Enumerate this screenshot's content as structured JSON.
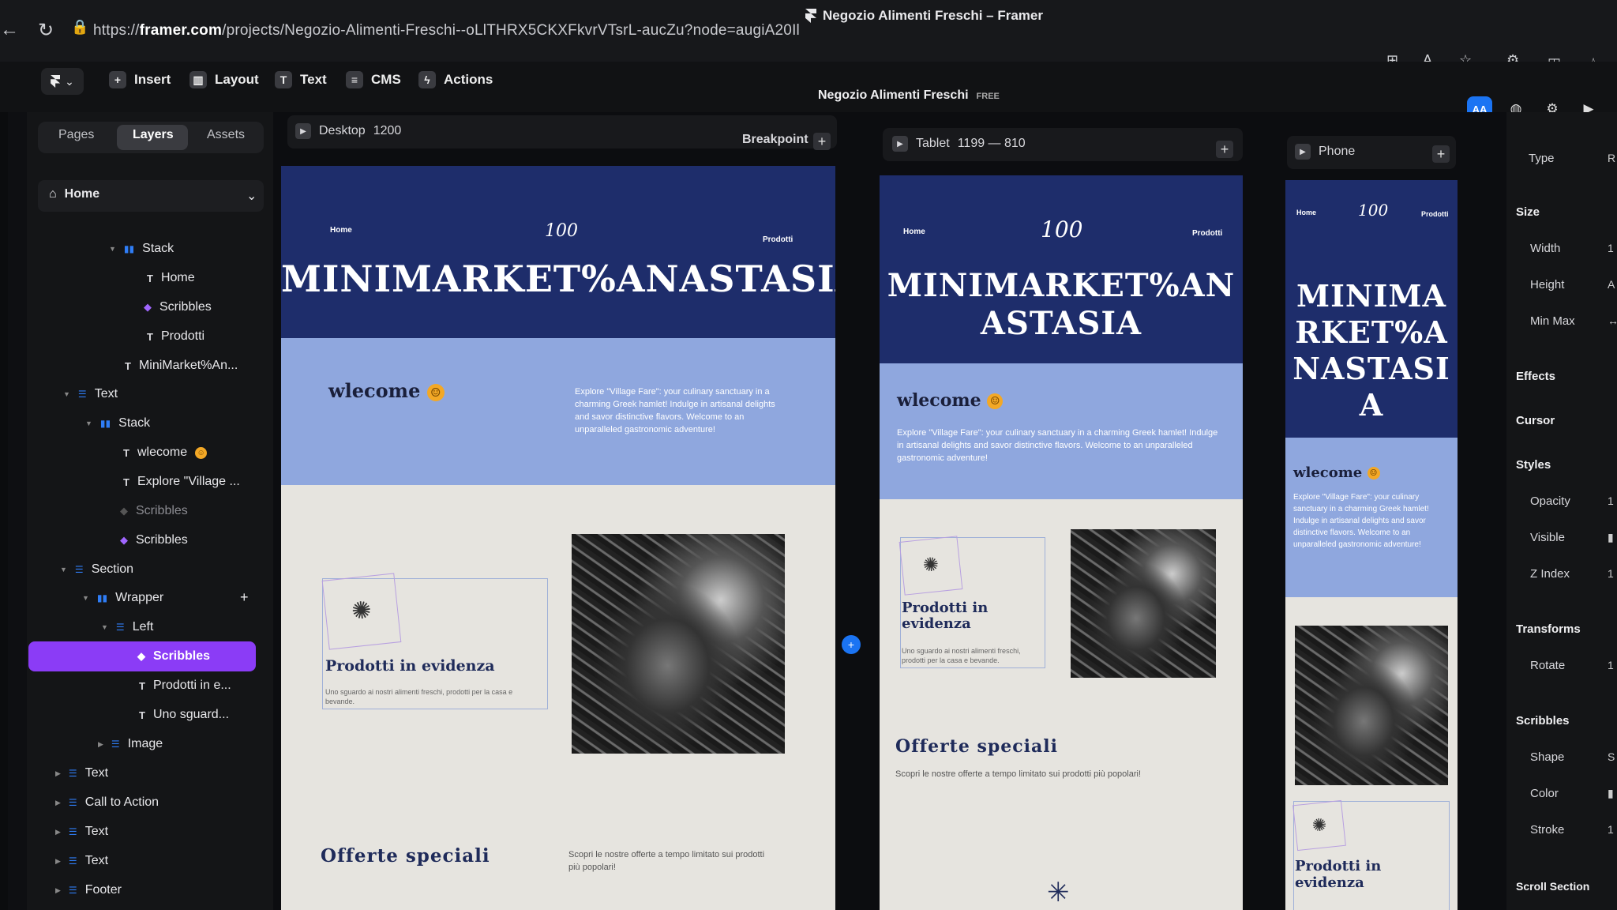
{
  "browser": {
    "tab_title": "Negozio Alimenti Freschi – Framer",
    "url_prefix": "https://",
    "url_host": "framer.com",
    "url_path": "/projects/Negozio-Alimenti-Freschi--oLlTHRX5CKXFkvrVTsrL-aucZu?node=augiA20Il"
  },
  "toolbar": {
    "insert": "Insert",
    "layout": "Layout",
    "text": "Text",
    "cms": "CMS",
    "actions": "Actions",
    "project_name": "Negozio Alimenti Freschi",
    "plan": "FREE",
    "aa": "AA"
  },
  "left_panel": {
    "tabs": [
      "Pages",
      "Layers",
      "Assets"
    ],
    "page_select": "Home",
    "layers": [
      {
        "label": "Stack",
        "kind": "stack"
      },
      {
        "label": "Home",
        "kind": "text"
      },
      {
        "label": "Scribbles",
        "kind": "component"
      },
      {
        "label": "Prodotti",
        "kind": "text"
      },
      {
        "label": "MiniMarket%An...",
        "kind": "text"
      },
      {
        "label": "Text",
        "kind": "stack"
      },
      {
        "label": "Stack",
        "kind": "stack"
      },
      {
        "label": "wlecome",
        "kind": "text"
      },
      {
        "label": "Explore \"Village ...",
        "kind": "text"
      },
      {
        "label": "Scribbles",
        "kind": "component"
      },
      {
        "label": "Scribbles",
        "kind": "component"
      },
      {
        "label": "Section",
        "kind": "stack"
      },
      {
        "label": "Wrapper",
        "kind": "stack"
      },
      {
        "label": "Left",
        "kind": "stack"
      },
      {
        "label": "Scribbles",
        "kind": "component"
      },
      {
        "label": "Prodotti in e...",
        "kind": "text"
      },
      {
        "label": "Uno sguard...",
        "kind": "text"
      },
      {
        "label": "Image",
        "kind": "stack"
      },
      {
        "label": "Text",
        "kind": "stack"
      },
      {
        "label": "Call to Action",
        "kind": "stack"
      },
      {
        "label": "Text",
        "kind": "stack"
      },
      {
        "label": "Text",
        "kind": "stack"
      },
      {
        "label": "Footer",
        "kind": "stack"
      }
    ]
  },
  "canvas": {
    "desktop_label": "Desktop",
    "desktop_width": "1200",
    "breakpoint": "Breakpoint",
    "tablet_label": "Tablet",
    "tablet_range": "1199 — 810",
    "phone_label": "Phone"
  },
  "site": {
    "nav_home": "Home",
    "nav_prodotti": "Prodotti",
    "logo": "100",
    "title": "MINIMARKET%ANASTASIA",
    "title_tablet_1": "MINIMARKET%AN",
    "title_tablet_2": "ASTASIA",
    "title_phone_1": "MINIMA",
    "title_phone_2": "RKET%A",
    "title_phone_3": "NASTASI",
    "title_phone_4": "A",
    "welcome": "wlecome",
    "welcome_text": "Explore \"Village Fare\": your culinary sanctuary in a charming Greek hamlet! Indulge in artisanal delights and savor distinctive flavors. Welcome to an unparalleled gastronomic adventure!",
    "featured_title": "Prodotti in evidenza",
    "featured_text": "Uno sguardo ai nostri alimenti freschi, prodotti per la casa e bevande.",
    "offers_title": "Offerte speciali",
    "offers_text": "Scopri le nostre offerte a tempo limitato sui prodotti più popolari!"
  },
  "right_panel": {
    "type": "Type",
    "size": "Size",
    "width": "Width",
    "height": "Height",
    "minmax": "Min Max",
    "effects": "Effects",
    "cursor": "Cursor",
    "styles": "Styles",
    "opacity": "Opacity",
    "visible": "Visible",
    "zindex": "Z Index",
    "transforms": "Transforms",
    "rotate": "Rotate",
    "scribbles": "Scribbles",
    "shape": "Shape",
    "color": "Color",
    "stroke": "Stroke",
    "scroll_section": "Scroll Section"
  },
  "colors": {
    "accent": "#8b3cf6",
    "brand_blue": "#1b74f3",
    "hero": "#1e2d6b",
    "welcome": "#8fa7de"
  }
}
